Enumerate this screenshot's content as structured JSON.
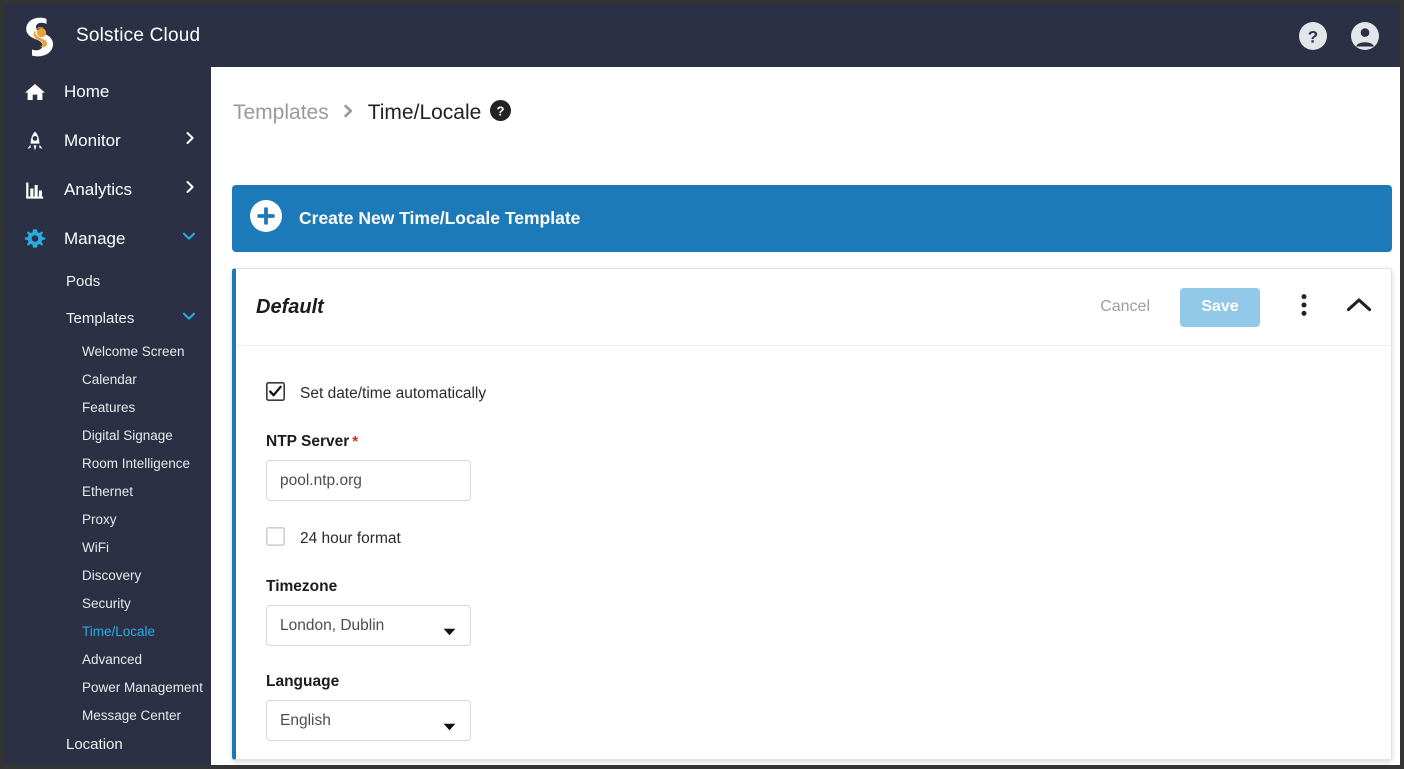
{
  "header": {
    "brand": "Solstice Cloud",
    "logo_icon": "solstice-s-logo",
    "help_icon": "help-circle-icon",
    "account_icon": "account-circle-icon"
  },
  "colors": {
    "sidebar_bg": "#2b3044",
    "accent_cyan": "#29abe2",
    "accent_blue": "#1d7ab8",
    "save_disabled": "#92c9e8",
    "required_red": "#e02020",
    "logo_amber": "#e8a33d"
  },
  "sidebar": {
    "main_items": [
      {
        "label": "Home",
        "icon": "home-icon",
        "caret": "none",
        "active": false
      },
      {
        "label": "Monitor",
        "icon": "rocket-icon",
        "caret": "right",
        "active": false
      },
      {
        "label": "Analytics",
        "icon": "bar-chart-icon",
        "caret": "right",
        "active": false
      },
      {
        "label": "Manage",
        "icon": "gear-icon",
        "caret": "down",
        "active": true
      }
    ],
    "manage_children": [
      {
        "label": "Pods",
        "caret": "none"
      },
      {
        "label": "Templates",
        "caret": "down"
      }
    ],
    "template_items": [
      {
        "label": "Welcome Screen",
        "selected": false
      },
      {
        "label": "Calendar",
        "selected": false
      },
      {
        "label": "Features",
        "selected": false
      },
      {
        "label": "Digital Signage",
        "selected": false
      },
      {
        "label": "Room Intelligence",
        "selected": false
      },
      {
        "label": "Ethernet",
        "selected": false
      },
      {
        "label": "Proxy",
        "selected": false
      },
      {
        "label": "WiFi",
        "selected": false
      },
      {
        "label": "Discovery",
        "selected": false
      },
      {
        "label": "Security",
        "selected": false
      },
      {
        "label": "Time/Locale",
        "selected": true
      },
      {
        "label": "Advanced",
        "selected": false
      },
      {
        "label": "Power Management",
        "selected": false
      },
      {
        "label": "Message Center",
        "selected": false
      },
      {
        "label": "Location",
        "selected": false
      }
    ]
  },
  "breadcrumb": {
    "parent": "Templates",
    "separator_icon": "chevron-right-icon",
    "current": "Time/Locale",
    "help_icon": "help-circle-icon"
  },
  "create_banner": {
    "label": "Create New Time/Locale Template",
    "icon": "plus-circle-icon"
  },
  "card": {
    "title": "Default",
    "cancel_label": "Cancel",
    "save_label": "Save",
    "menu_icon": "kebab-menu-icon",
    "collapse_icon": "chevron-up-icon",
    "form": {
      "auto_datetime": {
        "label": "Set date/time automatically",
        "checked": true
      },
      "ntp_server": {
        "label": "NTP Server",
        "required_marker": "*",
        "value": "pool.ntp.org",
        "placeholder": "pool.ntp.org"
      },
      "hour_format": {
        "label": "24 hour format",
        "checked": false
      },
      "timezone": {
        "label": "Timezone",
        "value": "London, Dublin",
        "arrow_icon": "chevron-down-icon"
      },
      "language": {
        "label": "Language",
        "value": "English",
        "arrow_icon": "chevron-down-icon"
      }
    }
  }
}
